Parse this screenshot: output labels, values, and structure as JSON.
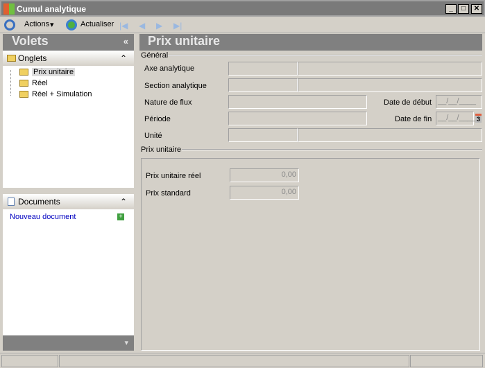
{
  "window": {
    "title": "Cumul analytique"
  },
  "toolbar": {
    "actions": "Actions",
    "refresh": "Actualiser"
  },
  "left": {
    "title": "Volets",
    "collapse": "«",
    "onglets": "Onglets",
    "tabs": [
      "Prix unitaire",
      "Réel",
      "Réel + Simulation"
    ],
    "documents": "Documents",
    "new_doc": "Nouveau document"
  },
  "main": {
    "title": "Prix unitaire",
    "general": "Général",
    "fields": {
      "axe": "Axe analytique",
      "section": "Section analytique",
      "nature": "Nature de flux",
      "periode": "Période",
      "unite": "Unité",
      "date_debut": "Date de début",
      "date_fin": "Date de fin",
      "date_placeholder": "__/__/____"
    },
    "prix_group": "Prix unitaire",
    "prix_reel": "Prix unitaire réel",
    "prix_reel_val": "0,00",
    "prix_std": "Prix standard",
    "prix_std_val": "0,00",
    "calendar_day": "3"
  }
}
